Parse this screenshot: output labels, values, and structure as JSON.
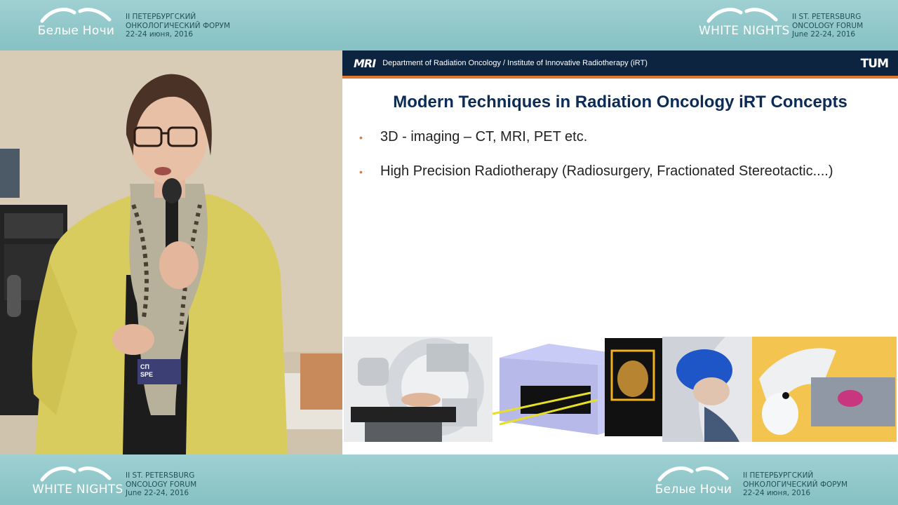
{
  "banner_top_left": {
    "brand": "Белые Ночи",
    "line1": "II ПЕТЕРБУРГСКИЙ",
    "line2": "ОНКОЛОГИЧЕСКИЙ ФОРУМ",
    "line3": "22-24 июня, 2016"
  },
  "banner_top_right": {
    "brand": "WHITE NIGHTS",
    "line1": "II ST. PETERSBURG",
    "line2": "ONCOLOGY FORUM",
    "line3": "June 22-24, 2016"
  },
  "banner_bottom_left": {
    "brand": "WHITE NIGHTS",
    "line1": "II ST. PETERSBURG",
    "line2": "ONCOLOGY FORUM",
    "line3": "June 22-24, 2016"
  },
  "banner_bottom_right": {
    "brand": "Белые Ночи",
    "line1": "II ПЕТЕРБУРГСКИЙ",
    "line2": "ОНКОЛОГИЧЕСКИЙ ФОРУМ",
    "line3": "22-24 июня, 2016"
  },
  "slide": {
    "header_logo": "MRI",
    "department": "Department of Radiation Oncology / Institute of Innovative Radiotherapy (iRT)",
    "header_right_logo": "TUM",
    "title": "Modern Techniques in Radiation Oncology iRT Concepts",
    "bullets": [
      "3D - imaging – CT, MRI, PET etc.",
      "High Precision Radiotherapy (Radiosurgery, Fractionated Stereotactic....)"
    ],
    "accent_color": "#e07830",
    "header_color": "#0c2440"
  },
  "badge": {
    "line1": "СП",
    "line2": "SPE"
  }
}
